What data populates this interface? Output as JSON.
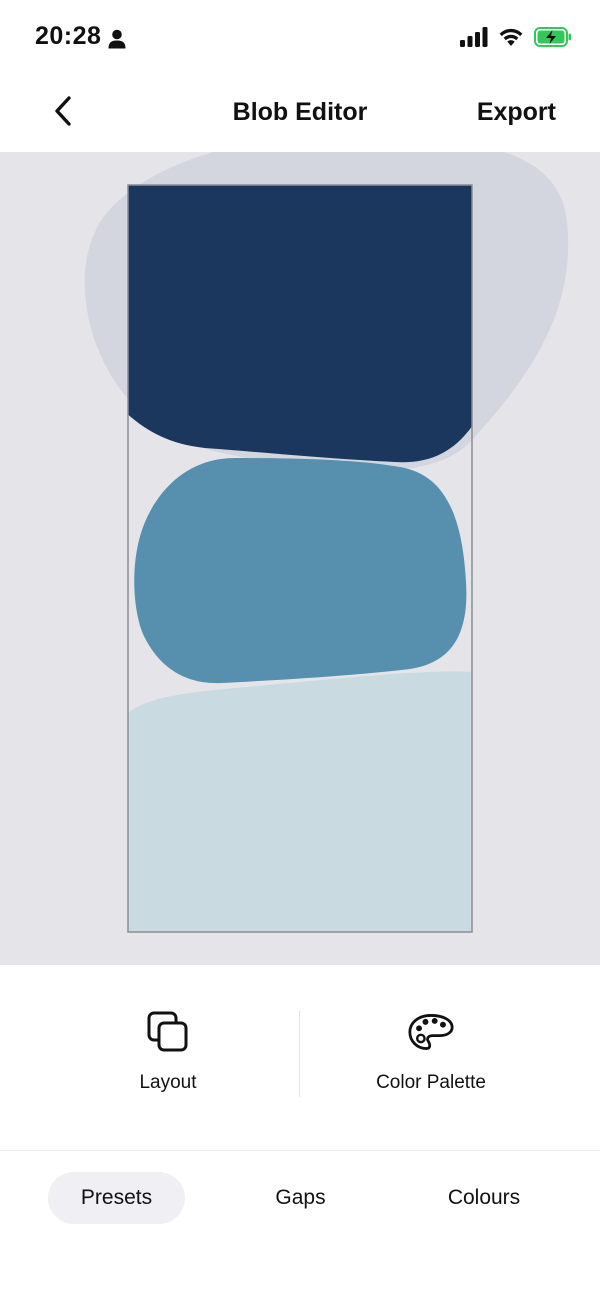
{
  "status_bar": {
    "time": "20:28",
    "icons": [
      "person-icon",
      "cellular-signal-icon",
      "wifi-icon",
      "battery-charging-icon"
    ],
    "battery_color": "#34c759"
  },
  "header": {
    "back_icon": "chevron-left-icon",
    "title": "Blob Editor",
    "export_label": "Export"
  },
  "canvas": {
    "background_color": "#e4e4e9",
    "backdrop_blob_color": "#d3d6de",
    "blobs": [
      {
        "name": "top-blob",
        "color": "#1c375d"
      },
      {
        "name": "middle-blob",
        "color": "#5690ae"
      },
      {
        "name": "bottom-blob",
        "color": "#c9dbe0"
      }
    ],
    "frame_color": "#8a8d93"
  },
  "tools": {
    "layout": {
      "label": "Layout",
      "icon": "layers-icon"
    },
    "color_palette": {
      "label": "Color Palette",
      "icon": "palette-icon"
    }
  },
  "tabs": [
    {
      "label": "Presets",
      "selected": true
    },
    {
      "label": "Gaps",
      "selected": false
    },
    {
      "label": "Colours",
      "selected": false
    }
  ]
}
